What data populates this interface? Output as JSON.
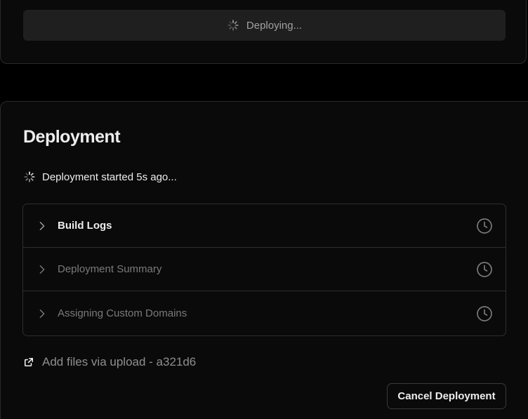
{
  "top_card": {
    "deploying_label": "Deploying..."
  },
  "deployment": {
    "title": "Deployment",
    "status_text": "Deployment started 5s ago...",
    "steps": [
      {
        "label": "Build Logs",
        "state": "active"
      },
      {
        "label": "Deployment Summary",
        "state": "pending"
      },
      {
        "label": "Assigning Custom Domains",
        "state": "pending"
      }
    ],
    "commit_text": "Add files via upload - a321d6",
    "cancel_label": "Cancel Deployment"
  },
  "icons": {
    "spinner": "spinner-icon",
    "chevron": "chevron-right-icon",
    "clock": "clock-icon",
    "external_link": "external-link-icon"
  },
  "colors": {
    "background": "#000000",
    "card": "#0a0a0a",
    "bar": "#1f1f1f",
    "border": "#2e2e2e",
    "text": "#ededed",
    "muted": "#7a7a7a"
  }
}
